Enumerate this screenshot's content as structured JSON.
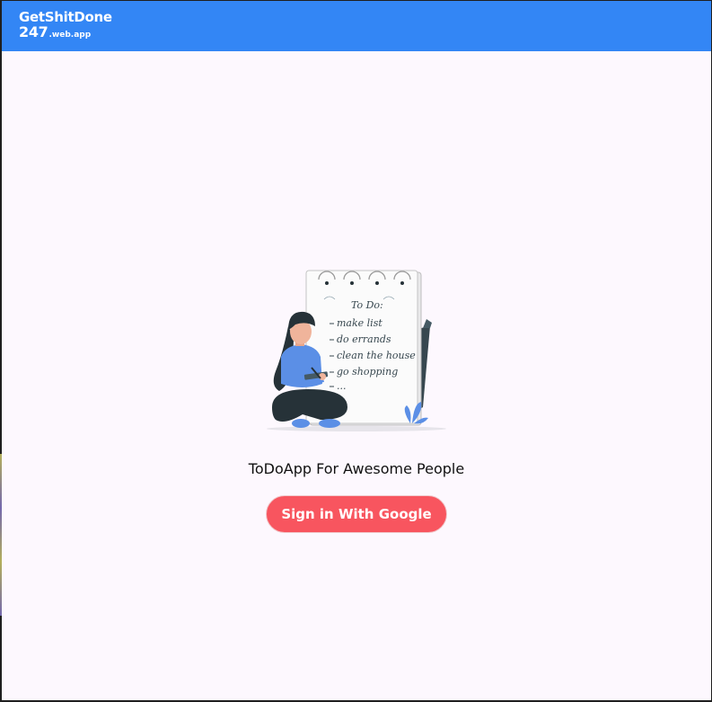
{
  "header": {
    "logo_line1": "GetShitDone",
    "logo_number": "247",
    "logo_domain": ".web.app"
  },
  "illustration": {
    "note_title": "To Do:",
    "note_items": [
      "make list",
      "do errands",
      "clean the house",
      "go shopping",
      "..."
    ]
  },
  "main": {
    "tagline": "ToDoApp For Awesome People",
    "signin_label": "Sign in With Google"
  },
  "colors": {
    "header_bg": "#3386f5",
    "page_bg": "#fdf8fe",
    "button_bg": "#f8555f",
    "accent_blue": "#5b8fe6"
  }
}
